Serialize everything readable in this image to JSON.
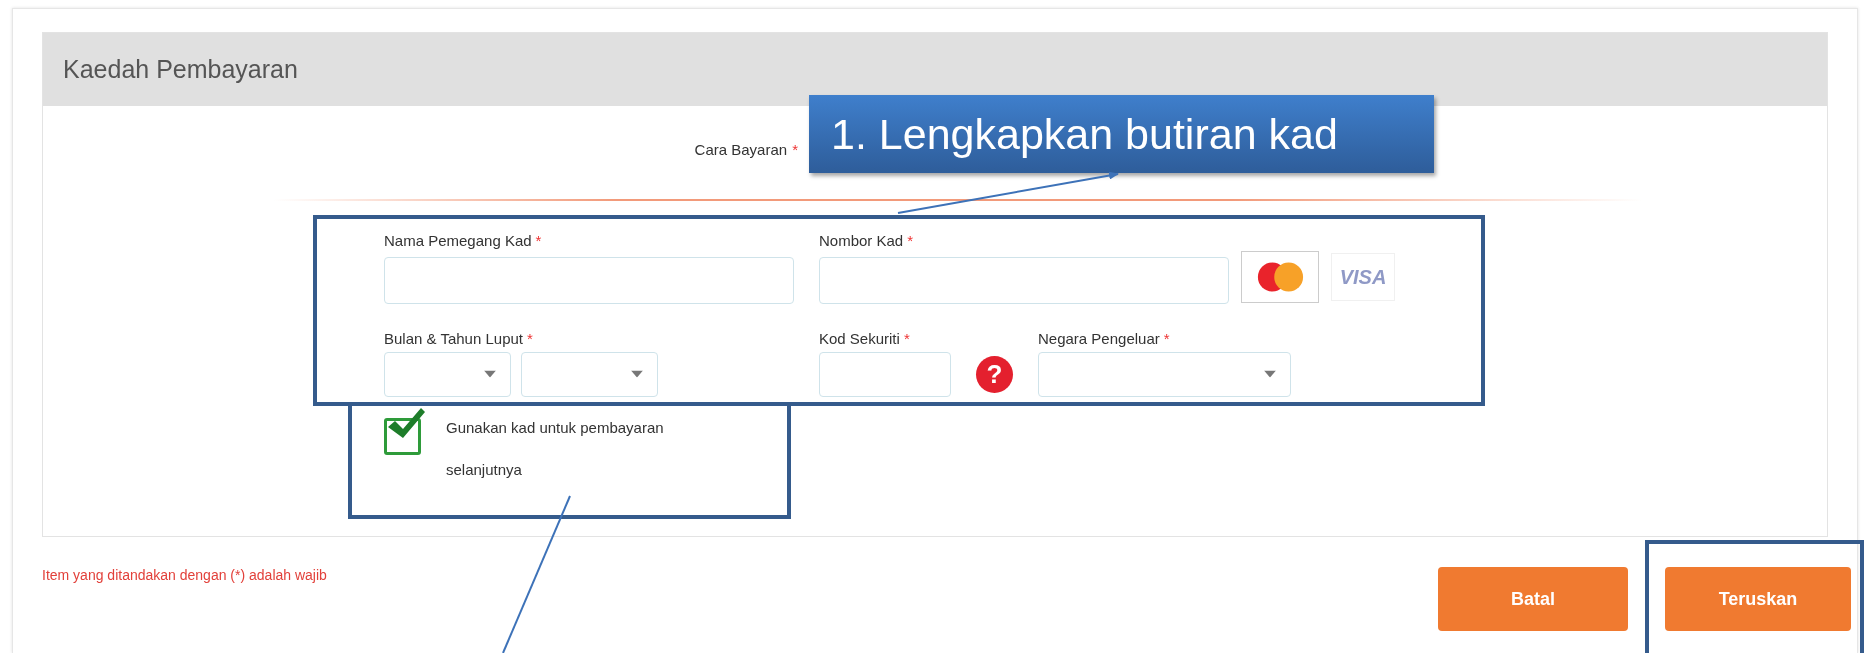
{
  "panel": {
    "title": "Kaedah Pembayaran"
  },
  "payment_method": {
    "label": "Cara Bayaran",
    "mark": "*"
  },
  "callout": {
    "text": "1. Lengkapkan butiran kad"
  },
  "fields": [
    {
      "kind": "text",
      "label": "Nama Pemegang Kad",
      "mark": "*"
    },
    {
      "kind": "text",
      "label": "Nombor Kad",
      "mark": "*"
    },
    {
      "kind": "month_year",
      "label": "Bulan & Tahun Luput",
      "mark": "*"
    },
    {
      "kind": "code",
      "label": "Kod Sekuriti",
      "mark": "*",
      "help": "?"
    },
    {
      "kind": "select",
      "label": "Negara Pengeluar",
      "mark": "*"
    }
  ],
  "card_brands": [
    {
      "kind": "mastercard"
    },
    {
      "kind": "visa",
      "label": "VISA"
    }
  ],
  "save_card": {
    "label": "Gunakan kad untuk pembayaran selanjutnya",
    "checked": true
  },
  "required_note": "Item yang ditandakan dengan (*) adalah wajib",
  "buttons": [
    {
      "label": "Batal",
      "highlighted": false
    },
    {
      "label": "Teruskan",
      "highlighted": true
    }
  ]
}
